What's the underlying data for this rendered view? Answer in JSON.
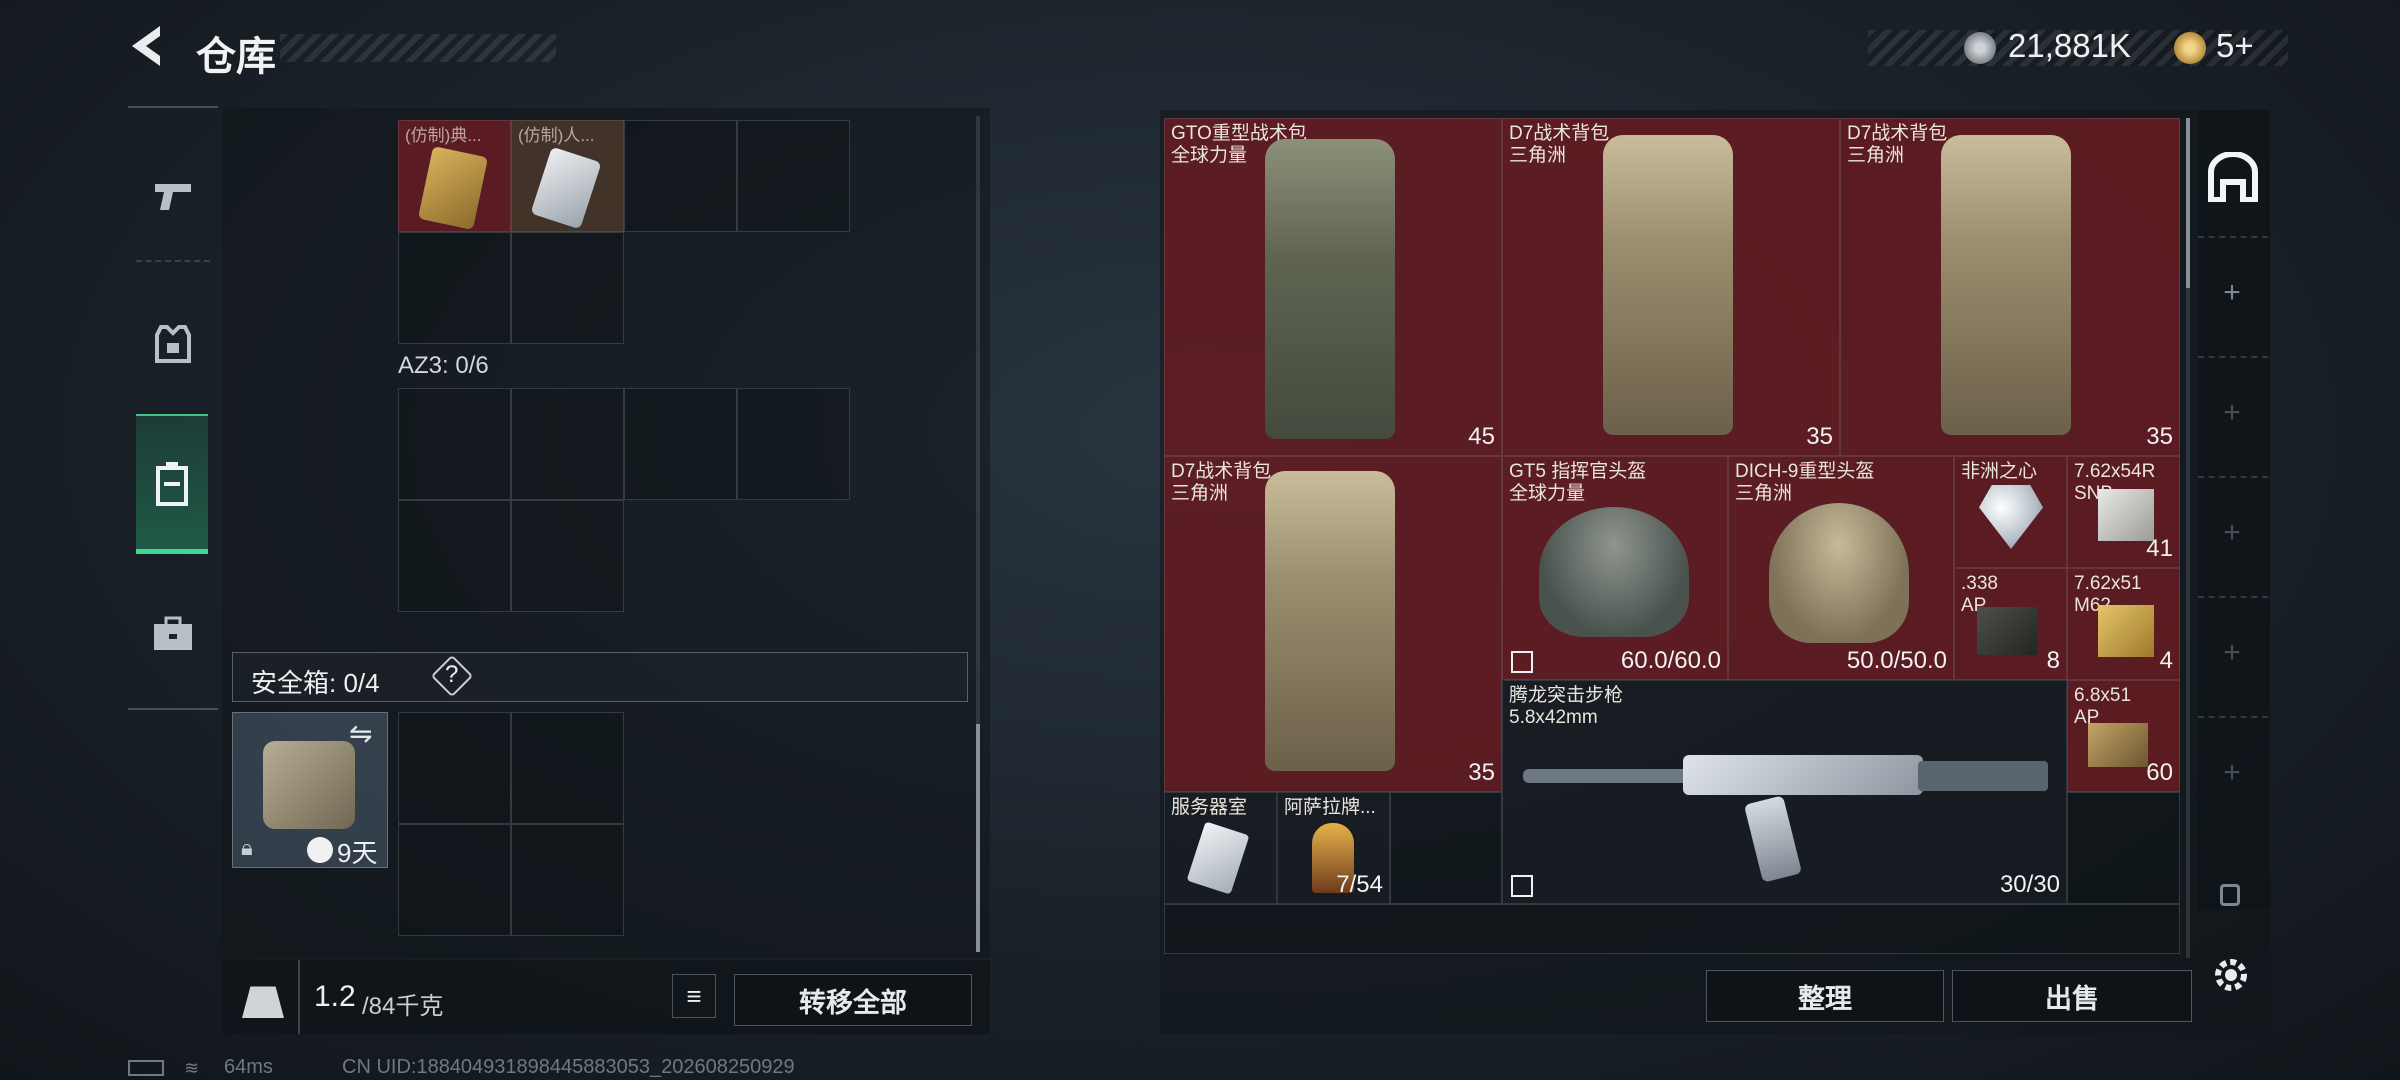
{
  "header": {
    "title": "仓库",
    "currency": "21,881K",
    "tickets": "5+"
  },
  "left": {
    "top_items": [
      {
        "name": "(仿制)典..."
      },
      {
        "name": "(仿制)人..."
      }
    ],
    "container_label": "AZ3: 0/6",
    "safe_box_label": "安全箱: 0/4",
    "safe_box_help": "?",
    "safe_box_timer": "9天",
    "weight_value": "1.2",
    "weight_unit": "/84千克",
    "transfer_all": "转移全部"
  },
  "stash": {
    "items": [
      {
        "id": "gto",
        "name": "GTO重型战术包",
        "sub": "全球力量",
        "count": "45"
      },
      {
        "id": "d7a",
        "name": "D7战术背包",
        "sub": "三角洲",
        "count": "35"
      },
      {
        "id": "d7b",
        "name": "D7战术背包",
        "sub": "三角洲",
        "count": "35"
      },
      {
        "id": "d7c",
        "name": "D7战术背包",
        "sub": "三角洲",
        "count": "35"
      },
      {
        "id": "gt5",
        "name": "GT5 指挥官头盔",
        "sub": "全球力量",
        "count": "60.0/60.0"
      },
      {
        "id": "dich",
        "name": "DICH-9重型头盔",
        "sub": "三角洲",
        "count": "50.0/50.0"
      },
      {
        "id": "heart",
        "name": "非洲之心",
        "sub": "",
        "count": ""
      },
      {
        "id": "sniper",
        "name": "7.62x54R",
        "sub": "SNB",
        "count": "41"
      },
      {
        "id": "ap338",
        "name": ".338",
        "sub": "AP",
        "count": "8"
      },
      {
        "id": "m62",
        "name": "7.62x51",
        "sub": "M62",
        "count": "4"
      },
      {
        "id": "rifle",
        "name": "腾龙突击步枪",
        "sub": "5.8x42mm",
        "count": "30/30"
      },
      {
        "id": "ap68",
        "name": "6.8x51",
        "sub": "AP",
        "count": "60"
      },
      {
        "id": "server",
        "name": "服务器室",
        "sub": "",
        "count": ""
      },
      {
        "id": "asala",
        "name": "阿萨拉牌...",
        "sub": "",
        "count": "7/54"
      }
    ],
    "sort_button": "整理",
    "sell_button": "出售"
  },
  "footer": {
    "ping": "64ms",
    "uid": "CN UID:18840493189844588305​3_202608250929"
  }
}
